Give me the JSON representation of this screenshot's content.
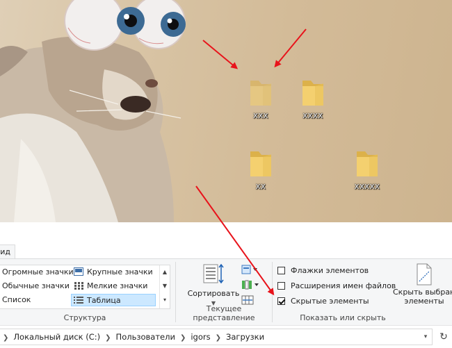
{
  "desktop": {
    "icons": [
      {
        "label": "XXX",
        "hidden": true
      },
      {
        "label": "XXXX",
        "hidden": false
      },
      {
        "label": "XX",
        "hidden": false
      },
      {
        "label": "XXXXX",
        "hidden": false
      }
    ]
  },
  "ribbon": {
    "active_tab": "Вид",
    "layout": {
      "items": [
        {
          "label": "Огромные значки",
          "selected": false
        },
        {
          "label": "Крупные значки",
          "selected": false
        },
        {
          "label": "Обычные значки",
          "selected": false
        },
        {
          "label": "Мелкие значки",
          "selected": false
        },
        {
          "label": "Список",
          "selected": false
        },
        {
          "label": "Таблица",
          "selected": true
        }
      ],
      "group_label": "Структура"
    },
    "current_view": {
      "sort_label": "Сортировать",
      "group_label": "Текущее представление"
    },
    "show_hide": {
      "checkboxes": [
        {
          "label": "Флажки элементов",
          "checked": false
        },
        {
          "label": "Расширения имен файлов",
          "checked": false
        },
        {
          "label": "Скрытые элементы",
          "checked": true
        }
      ],
      "hide_selected_line1": "Скрыть выбранные",
      "hide_selected_line2": "элементы",
      "group_label": "Показать или скрыть"
    }
  },
  "address_bar": {
    "crumbs": [
      "Локальный диск (C:)",
      "Пользователи",
      "igors",
      "Загрузки"
    ]
  },
  "colors": {
    "folder": "#f4d06f",
    "folder_dark": "#dcb14a",
    "arrow": "#e8131b",
    "selection": "#cce8ff"
  }
}
